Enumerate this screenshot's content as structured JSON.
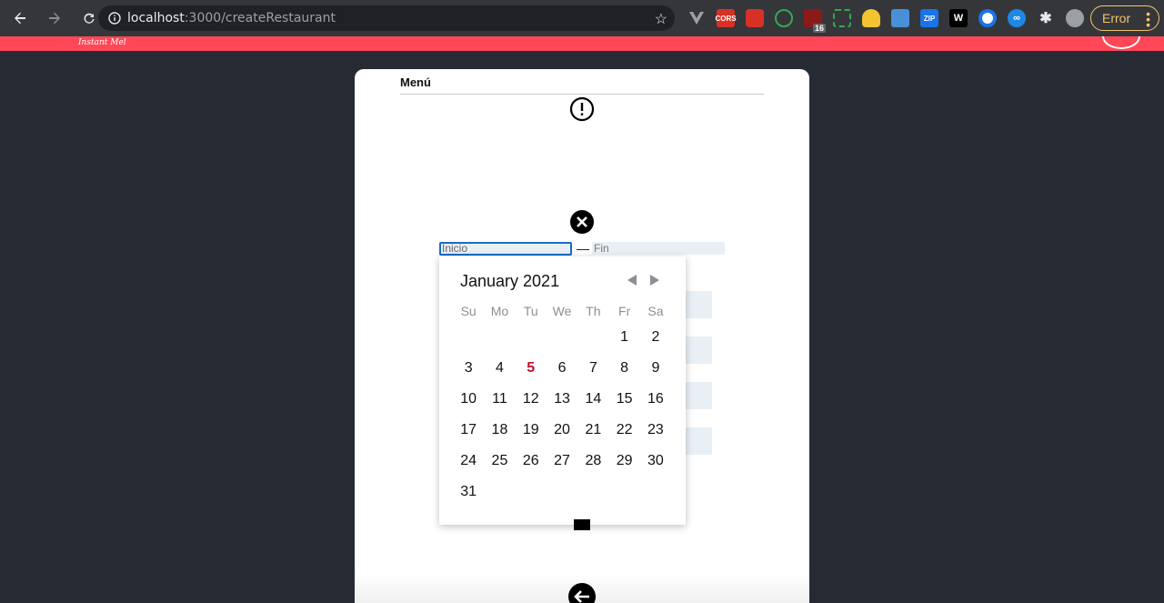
{
  "browser": {
    "url_host": "localhost",
    "url_path": ":3000/createRestaurant",
    "error_label": "Error",
    "extensions": [
      "vue-devtools-icon",
      "cors-icon",
      "extension-red-icon",
      "extension-target-icon",
      "extension-badge-icon",
      "extension-dashed-icon",
      "ghost-icon",
      "extension-blue-icon",
      "zip-icon",
      "extension-w-icon",
      "extension-circle-icon",
      "extension-infinity-icon",
      "puzzle-icon",
      "profile-icon"
    ],
    "badge_count": "16",
    "ext_labels": {
      "cors": "CORS",
      "zip": "ZIP",
      "w": "W"
    }
  },
  "app": {
    "logo_subtitle": "Instant Mel"
  },
  "card": {
    "title": "Menú"
  },
  "date_range": {
    "start_value": "Inicio",
    "end_placeholder": "Fin",
    "separator": "—"
  },
  "calendar": {
    "month_label": "January 2021",
    "weekdays": [
      "Su",
      "Mo",
      "Tu",
      "We",
      "Th",
      "Fr",
      "Sa"
    ],
    "leading_blanks": 5,
    "days_in_month": 31,
    "today": 5
  },
  "colors": {
    "brand": "#ff4757",
    "today": "#c8102e",
    "focus": "#1b6ac9"
  }
}
